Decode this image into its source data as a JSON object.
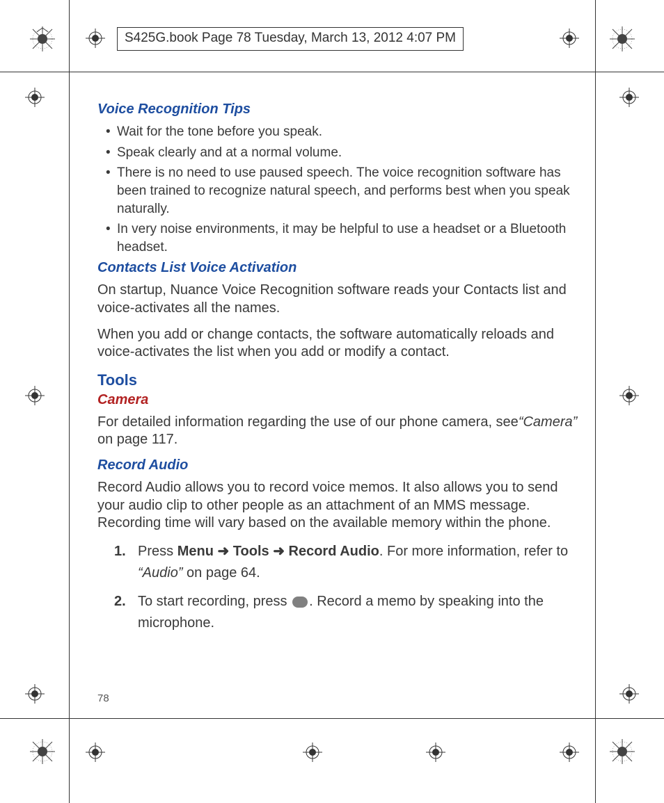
{
  "header": "S425G.book  Page 78  Tuesday, March 13, 2012  4:07 PM",
  "page_number": "78",
  "sections": {
    "voice_tips_heading": "Voice Recognition Tips",
    "voice_tips": [
      "Wait for the tone before you speak.",
      "Speak clearly and at a normal volume.",
      "There is no need to use paused speech. The voice recognition software has been trained to recognize natural speech, and performs best when you speak naturally.",
      "In very noise environments, it may be helpful to use a headset or a Bluetooth headset."
    ],
    "contacts_heading": "Contacts List Voice Activation",
    "contacts_p1": "On startup, Nuance Voice Recognition software reads your Contacts list and voice-activates all the names.",
    "contacts_p2": "When you add or change contacts, the software automatically reloads and voice-activates the list when you add or modify a contact.",
    "tools_heading": "Tools",
    "camera_heading": "Camera",
    "camera_body_pre": "For detailed information regarding the use of our phone camera, see",
    "camera_ref": "“Camera”",
    "camera_body_post": " on page 117.",
    "record_heading": "Record Audio",
    "record_body": "Record Audio allows you to record voice memos. It also allows you to send your audio clip to other people as an attachment of an MMS message. Recording time will vary based on the available memory within the phone.",
    "step1_num": "1.",
    "step1_press": "Press ",
    "step1_menu": "Menu",
    "step1_arrow": " ➜ ",
    "step1_tools": "Tools",
    "step1_record": "Record Audio",
    "step1_rest": ". For more information, refer to ",
    "step1_ref": "“Audio”",
    "step1_tail": " on page 64.",
    "step2_num": "2.",
    "step2_pre": "To start recording, press ",
    "step2_post": ". Record a memo by speaking into the microphone."
  }
}
